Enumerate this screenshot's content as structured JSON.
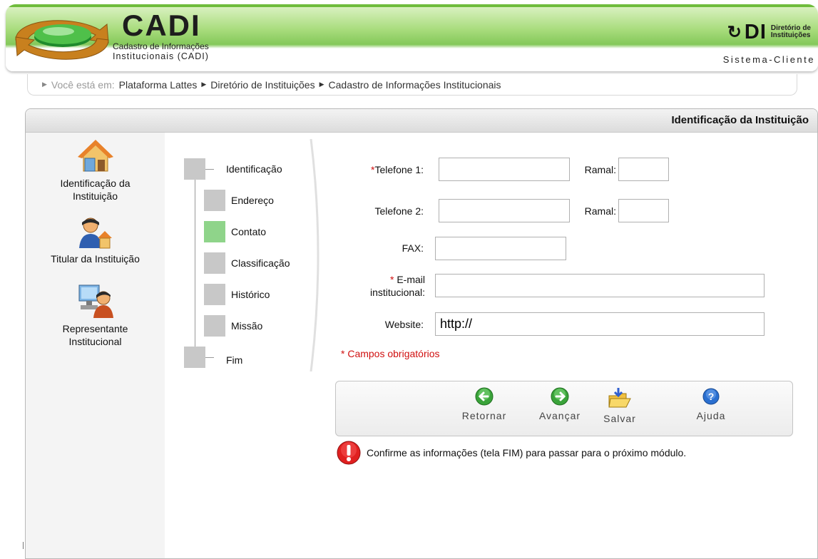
{
  "header": {
    "app_name": "CADI",
    "subtitle_line1": "Cadastro de Informações",
    "subtitle_line2": "Institucionais (CADI)",
    "di_letters": "DI",
    "di_name_line1": "Diretório de",
    "di_name_line2": "Instituições",
    "system_name": "Sistema-Cliente"
  },
  "breadcrumb": {
    "prefix": "Você está em:",
    "items": [
      "Plataforma Lattes",
      "Diretório de Instituições",
      "Cadastro de Informações Institucionais"
    ]
  },
  "panel": {
    "title": "Identificação da Instituição"
  },
  "left_nav": {
    "items": [
      {
        "label_line1": "Identificação da",
        "label_line2": "Instituição",
        "icon": "house-icon"
      },
      {
        "label_line1": "Titular da Instituição",
        "label_line2": "",
        "icon": "person-house-icon"
      },
      {
        "label_line1": "Representante",
        "label_line2": "Institucional",
        "icon": "person-computer-icon"
      }
    ]
  },
  "steps": {
    "items": [
      "Identificação",
      "Endereço",
      "Contato",
      "Classificação",
      "Histórico",
      "Missão",
      "Fim"
    ],
    "active": "Contato"
  },
  "form": {
    "required_marker": "*",
    "phone1_label": "Telefone 1:",
    "phone1_value": "",
    "ramal1_label": "Ramal:",
    "ramal1_value": "",
    "phone2_label": "Telefone 2:",
    "phone2_value": "",
    "ramal2_label": "Ramal:",
    "ramal2_value": "",
    "fax_label": "FAX:",
    "fax_value": "",
    "email_label_line1": "E-mail",
    "email_label_line2": "institucional:",
    "email_value": "",
    "website_label": "Website:",
    "website_value": "http://",
    "required_note": "* Campos obrigatórios"
  },
  "actions": {
    "back": "Retornar",
    "next": "Avançar",
    "save": "Salvar",
    "help": "Ajuda"
  },
  "message": "Confirme as informações (tela FIM) para passar para o próximo módulo.",
  "colors": {
    "header_green": "#84c85a",
    "active_step": "#8fd48a",
    "required_red": "#d01010",
    "arrow_green": "#3aa33a",
    "help_blue": "#2a6fd0"
  }
}
